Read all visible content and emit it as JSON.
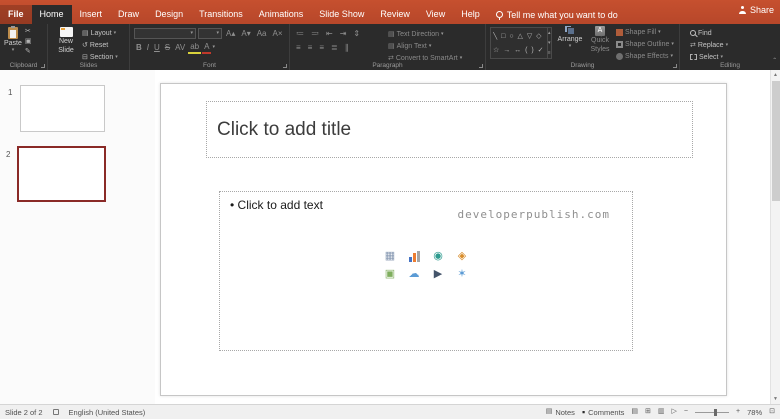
{
  "tabs": {
    "items": [
      "File",
      "Home",
      "Insert",
      "Draw",
      "Design",
      "Transitions",
      "Animations",
      "Slide Show",
      "Review",
      "View",
      "Help"
    ],
    "selected": "Home",
    "tell_me": "Tell me what you want to do",
    "share": "Share"
  },
  "ribbon": {
    "clipboard": {
      "group_label": "Clipboard",
      "paste": "Paste"
    },
    "slides": {
      "group_label": "Slides",
      "new_line1": "New",
      "new_line2": "Slide",
      "layout": "Layout",
      "reset": "Reset",
      "section": "Section"
    },
    "font": {
      "group_label": "Font",
      "font_name": "",
      "font_size": ""
    },
    "paragraph": {
      "group_label": "Paragraph",
      "text_direction": "Text Direction",
      "align_text": "Align Text",
      "convert_smartart": "Convert to SmartArt"
    },
    "drawing": {
      "group_label": "Drawing",
      "arrange": "Arrange",
      "quick_line1": "Quick",
      "quick_line2": "Styles",
      "shape_fill": "Shape Fill",
      "shape_outline": "Shape Outline",
      "shape_effects": "Shape Effects"
    },
    "editing": {
      "group_label": "Editing",
      "find": "Find",
      "replace": "Replace",
      "select": "Select"
    }
  },
  "thumbnails": {
    "slides": [
      {
        "number": "1"
      },
      {
        "number": "2"
      }
    ],
    "selected_number": "2"
  },
  "slide": {
    "title_placeholder": "Click to add title",
    "bullet": "•",
    "body_placeholder": "Click to add text",
    "watermark": "developerpublish.com"
  },
  "statusbar": {
    "slide_indicator": "Slide 2 of 2",
    "language": "English (United States)",
    "notes": "Notes",
    "comments": "Comments",
    "zoom": "78%"
  },
  "colors": {
    "titlebar_red": "#b7472a",
    "ribbon_bg": "#2b2b2b",
    "selection_border": "#8a2a27"
  },
  "icons": {
    "dropdown": "▾",
    "scissors": "✂",
    "copy": "▣",
    "format_painter": "✎",
    "layout": "▤",
    "reset": "↺",
    "section": "⊟",
    "font_inc": "A▴",
    "font_dec": "A▾",
    "change_case": "Aa",
    "clear_format": "A×",
    "bold": "B",
    "italic": "I",
    "underline": "U",
    "strikethrough": "S",
    "char_spacing": "AV",
    "highlight": "ab",
    "font_color": "A",
    "bullets": "≔",
    "numbering": "≕",
    "indent_less": "⇤",
    "indent_more": "⇥",
    "line_spacing": "⇕",
    "align_left": "≡",
    "align_center": "≡",
    "align_right": "≡",
    "justify": "≣",
    "columns": "∥",
    "text_direction": "▤",
    "align_text": "▤",
    "convert_smartart": "⇄",
    "shapes_row1": "╲ □ ○ △ ▽ ◇",
    "shapes_row2": "☆ → ↔ ( ) ✓",
    "gallery_up": "▴",
    "gallery_down": "▾",
    "gallery_more": "≡",
    "quick_styles_letter": "A",
    "replace": "⇄",
    "notes": "▤",
    "comments": "▪",
    "view_normal": "▤",
    "view_sorter": "⊞",
    "view_reading": "▥",
    "view_slideshow": "▷",
    "zoom_out": "−",
    "zoom_in": "+",
    "fit_window": "⊡",
    "scroll_up": "▲",
    "scroll_down": "▼",
    "collapse_ribbon": "ˆ",
    "content_table": "▦",
    "content_smartart": "◉",
    "content_3d": "◈",
    "content_picture": "▣",
    "content_online_picture": "☁",
    "content_video": "▶",
    "content_icons": "✶"
  }
}
